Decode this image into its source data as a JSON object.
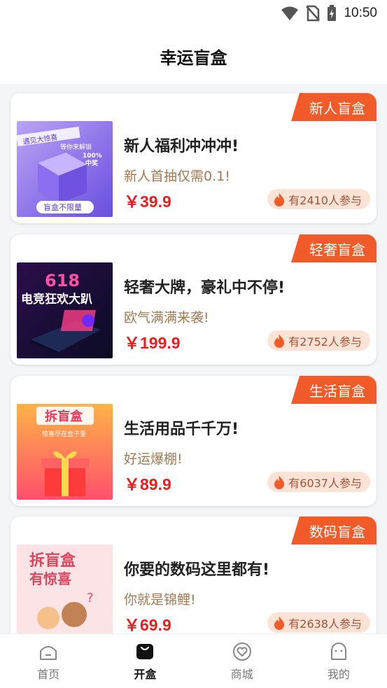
{
  "status_bar": {
    "time": "10:50"
  },
  "header": {
    "title": "幸运盲盒"
  },
  "boxes": [
    {
      "tag": "新人盲盒",
      "name": "新人福利冲冲冲!",
      "subtitle": "新人首抽仅需0.1!",
      "price": "￥39.9",
      "participants": "有2410人参与",
      "thumb_texts": {
        "top": "遇见大惊喜",
        "mid": "等你来解锁",
        "rate": "100%\n中奖",
        "bottom": "盲盒不限量"
      }
    },
    {
      "tag": "轻奢盲盒",
      "name": "轻奢大牌，豪礼中不停!",
      "subtitle": "欧气满满来袭!",
      "price": "￥199.9",
      "participants": "有2752人参与",
      "thumb_texts": {
        "top": "618",
        "mid": "电竞狂欢大趴"
      }
    },
    {
      "tag": "生活盲盒",
      "name": "生活用品千千万!",
      "subtitle": "好运爆棚!",
      "price": "￥89.9",
      "participants": "有6037人参与",
      "thumb_texts": {
        "top": "拆盲盒",
        "mid": "惊喜尽在盒子里"
      }
    },
    {
      "tag": "数码盲盒",
      "name": "你要的数码这里都有!",
      "subtitle": "你就是锦鲤!",
      "price": "￥69.9",
      "participants": "有2638人参与",
      "thumb_texts": {
        "top": "拆盲盒",
        "mid": "有惊喜"
      }
    }
  ],
  "tabbar": [
    {
      "label": "首页",
      "icon": "home-icon",
      "active": false
    },
    {
      "label": "开盒",
      "icon": "box-icon",
      "active": true
    },
    {
      "label": "商城",
      "icon": "mall-heart-icon",
      "active": false
    },
    {
      "label": "我的",
      "icon": "profile-icon",
      "active": false
    }
  ],
  "colors": {
    "accent": "#f15a29",
    "price": "#ee1c1c",
    "subtitle": "#a07a52",
    "badge_bg": "#fde3d6"
  }
}
